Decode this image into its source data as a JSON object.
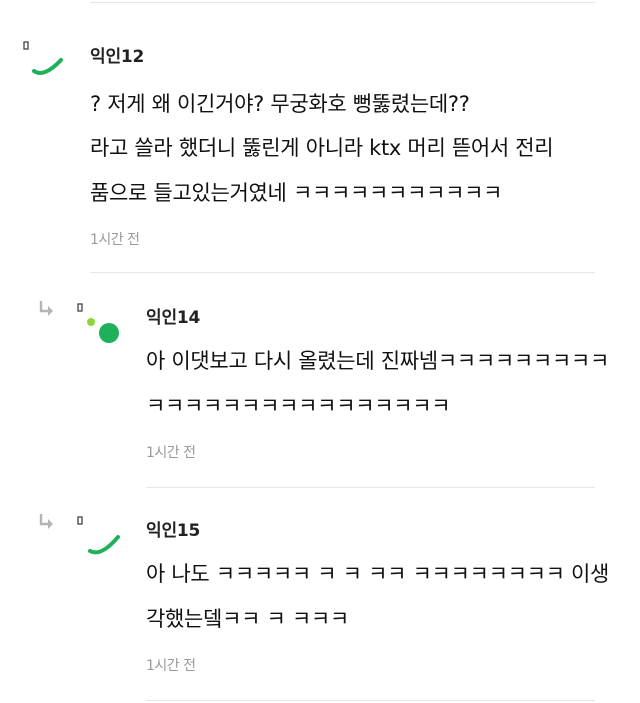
{
  "comments": [
    {
      "author": "익인12",
      "lines": [
        "? 저게 왜 이긴거야? 무궁화호 뻥뚫렸는데??",
        "라고 쓸라 했더니 뚫린게 아니라 ktx 머리 뜯어서 전리",
        "품으로 들고있는거였네 ㅋㅋㅋㅋㅋㅋㅋㅋㅋㅋㅋ"
      ],
      "time": "1시간 전",
      "avatar_color": "#1fb05a"
    },
    {
      "author": "익인14",
      "reply_icon": "reply-arrow-icon",
      "lines": [
        "아 이댓보고 다시 올렸는데 진짜넴ㅋㅋㅋㅋㅋㅋㅋㅋㅋ",
        "ㅋㅋㅋㅋㅋㅋㅋㅋㅋㅋㅋㅋㅋㅋㅋㅋ"
      ],
      "time": "1시간 전",
      "avatar_color": "#1fb05a",
      "avatar_accent": "#8cd63a"
    },
    {
      "author": "익인15",
      "reply_icon": "reply-arrow-icon",
      "lines": [
        "아 나도 ㅋㅋㅋㅋㅋ ㅋ ㅋ ㅋㅋ ㅋㅋㅋㅋㅋㅋㅋㅋ 이생",
        "각했는뎈ㅋㅋ ㅋ ㅋㅋㅋ"
      ],
      "time": "1시간 전",
      "avatar_color": "#1fb05a"
    }
  ]
}
